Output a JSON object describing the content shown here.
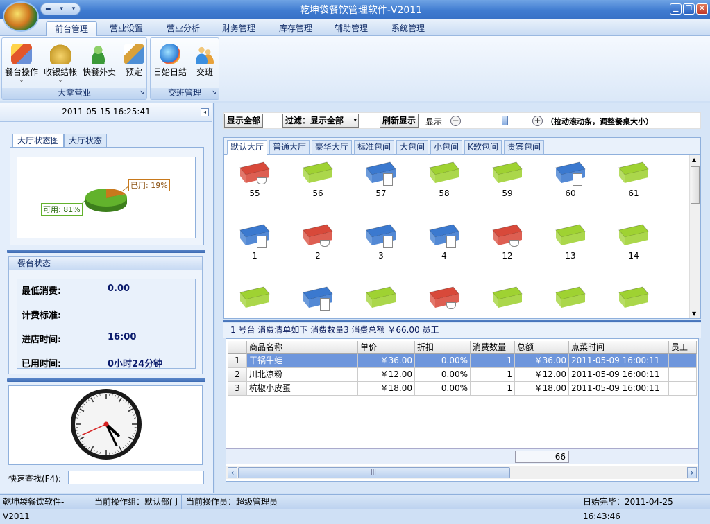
{
  "window": {
    "title": "乾坤袋餐饮管理软件-V2011",
    "qa_marks": "▬ ▾ ▾",
    "min": "▁",
    "max": "❐",
    "close": "✕"
  },
  "menu": {
    "tabs": [
      "前台管理",
      "营业设置",
      "营业分析",
      "财务管理",
      "库存管理",
      "辅助管理",
      "系统管理"
    ]
  },
  "ribbon": {
    "groups": [
      {
        "label": "大堂营业",
        "buttons": [
          {
            "label": "餐台操作",
            "icon": "pencil-icon",
            "dropdown": "⌄"
          },
          {
            "label": "收银结帐",
            "icon": "money-bag-icon",
            "dropdown": "⌄"
          },
          {
            "label": "快餐外卖",
            "icon": "delivery-person-icon",
            "dropdown": ""
          },
          {
            "label": "预定",
            "icon": "phone-icon",
            "dropdown": ""
          }
        ]
      },
      {
        "label": "交班管理",
        "buttons": [
          {
            "label": "日始日结",
            "icon": "globe-icon",
            "dropdown": ""
          },
          {
            "label": "交班",
            "icon": "people-icon",
            "dropdown": ""
          }
        ]
      }
    ],
    "corner_marker": "↘"
  },
  "left": {
    "datetime": "2011-05-15 16:25:41",
    "collapse": "◂",
    "tabs": [
      "大厅状态图",
      "大厅状态"
    ],
    "pie": {
      "used_label": "已用: 19%",
      "avail_label": "可用: 81%",
      "used_pct": 19,
      "avail_pct": 81,
      "colors": {
        "used": "#c8791c",
        "avail": "#62b22c"
      }
    },
    "table_state": {
      "title": "餐台状态",
      "rows": [
        {
          "label": "最低消费:",
          "value": "0.00"
        },
        {
          "label": "计费标准:",
          "value": ""
        },
        {
          "label": "进店时间:",
          "value": "16:00"
        },
        {
          "label": "已用时间:",
          "value": "0小时24分钟"
        }
      ]
    },
    "clock": {
      "hour": 4,
      "minute": 25,
      "second": 41
    },
    "search": {
      "label": "快速查找(F4):",
      "value": ""
    }
  },
  "right": {
    "toolbar": {
      "show_all": "显示全部",
      "filter": "过滤：显示全部",
      "filter_arrow": "▾",
      "refresh": "刷新显示",
      "display": "显示",
      "minus": "−",
      "plus": "+",
      "hint": "（拉动滚动条，调整餐桌大小）",
      "slider_value": 0.5
    },
    "hall_tabs": [
      "默认大厅",
      "普通大厅",
      "豪华大厅",
      "标准包间",
      "大包间",
      "小包间",
      "K歌包间",
      "贵宾包间"
    ],
    "tables": [
      {
        "num": "55",
        "state": "occupied",
        "badge": "cup"
      },
      {
        "num": "56",
        "state": "free",
        "badge": ""
      },
      {
        "num": "57",
        "state": "booked",
        "badge": "paper"
      },
      {
        "num": "58",
        "state": "free",
        "badge": ""
      },
      {
        "num": "59",
        "state": "free",
        "badge": ""
      },
      {
        "num": "60",
        "state": "booked",
        "badge": "paper"
      },
      {
        "num": "61",
        "state": "free",
        "badge": ""
      },
      {
        "num": "1",
        "state": "booked",
        "badge": "paper"
      },
      {
        "num": "2",
        "state": "occupied",
        "badge": "cup"
      },
      {
        "num": "3",
        "state": "booked",
        "badge": "paper"
      },
      {
        "num": "4",
        "state": "booked",
        "badge": "paper"
      },
      {
        "num": "12",
        "state": "occupied",
        "badge": "cup"
      },
      {
        "num": "13",
        "state": "free",
        "badge": ""
      },
      {
        "num": "14",
        "state": "free",
        "badge": ""
      },
      {
        "num": "",
        "state": "free",
        "badge": ""
      },
      {
        "num": "",
        "state": "booked",
        "badge": "paper"
      },
      {
        "num": "",
        "state": "free",
        "badge": ""
      },
      {
        "num": "",
        "state": "occupied",
        "badge": "cup"
      },
      {
        "num": "",
        "state": "free",
        "badge": ""
      },
      {
        "num": "",
        "state": "free",
        "badge": ""
      },
      {
        "num": "",
        "state": "free",
        "badge": ""
      }
    ],
    "state_colors": {
      "free": "#9fd232",
      "occupied": "#d8493a",
      "booked": "#3b79cf"
    },
    "scroll": {
      "up": "▲",
      "down": "▼",
      "left": "‹",
      "right": "›",
      "grip": "|||"
    },
    "info": "1 号台  消费清单如下  消费数量3  消费总额 ￥66.00  员工",
    "grid": {
      "columns": [
        "商品名称",
        "单价",
        "折扣",
        "消费数量",
        "总额",
        "点菜时间",
        "员工"
      ],
      "rows": [
        {
          "idx": "1",
          "name": "干锅牛蛙",
          "price": "￥36.00",
          "discount": "0.00%",
          "qty": "1",
          "total": "￥36.00",
          "time": "2011-05-09 16:00:11",
          "staff": ""
        },
        {
          "idx": "2",
          "name": "川北凉粉",
          "price": "￥12.00",
          "discount": "0.00%",
          "qty": "1",
          "total": "￥12.00",
          "time": "2011-05-09 16:00:11",
          "staff": ""
        },
        {
          "idx": "3",
          "name": "杭椒小皮蛋",
          "price": "￥18.00",
          "discount": "0.00%",
          "qty": "1",
          "total": "￥18.00",
          "time": "2011-05-09 16:00:11",
          "staff": ""
        }
      ],
      "footer_total": "66"
    }
  },
  "status": [
    "乾坤袋餐饮软件-V2011",
    "当前操作组：默认部门",
    "当前操作员：超级管理员",
    "日始完毕：2011-04-25 16:43:46"
  ]
}
